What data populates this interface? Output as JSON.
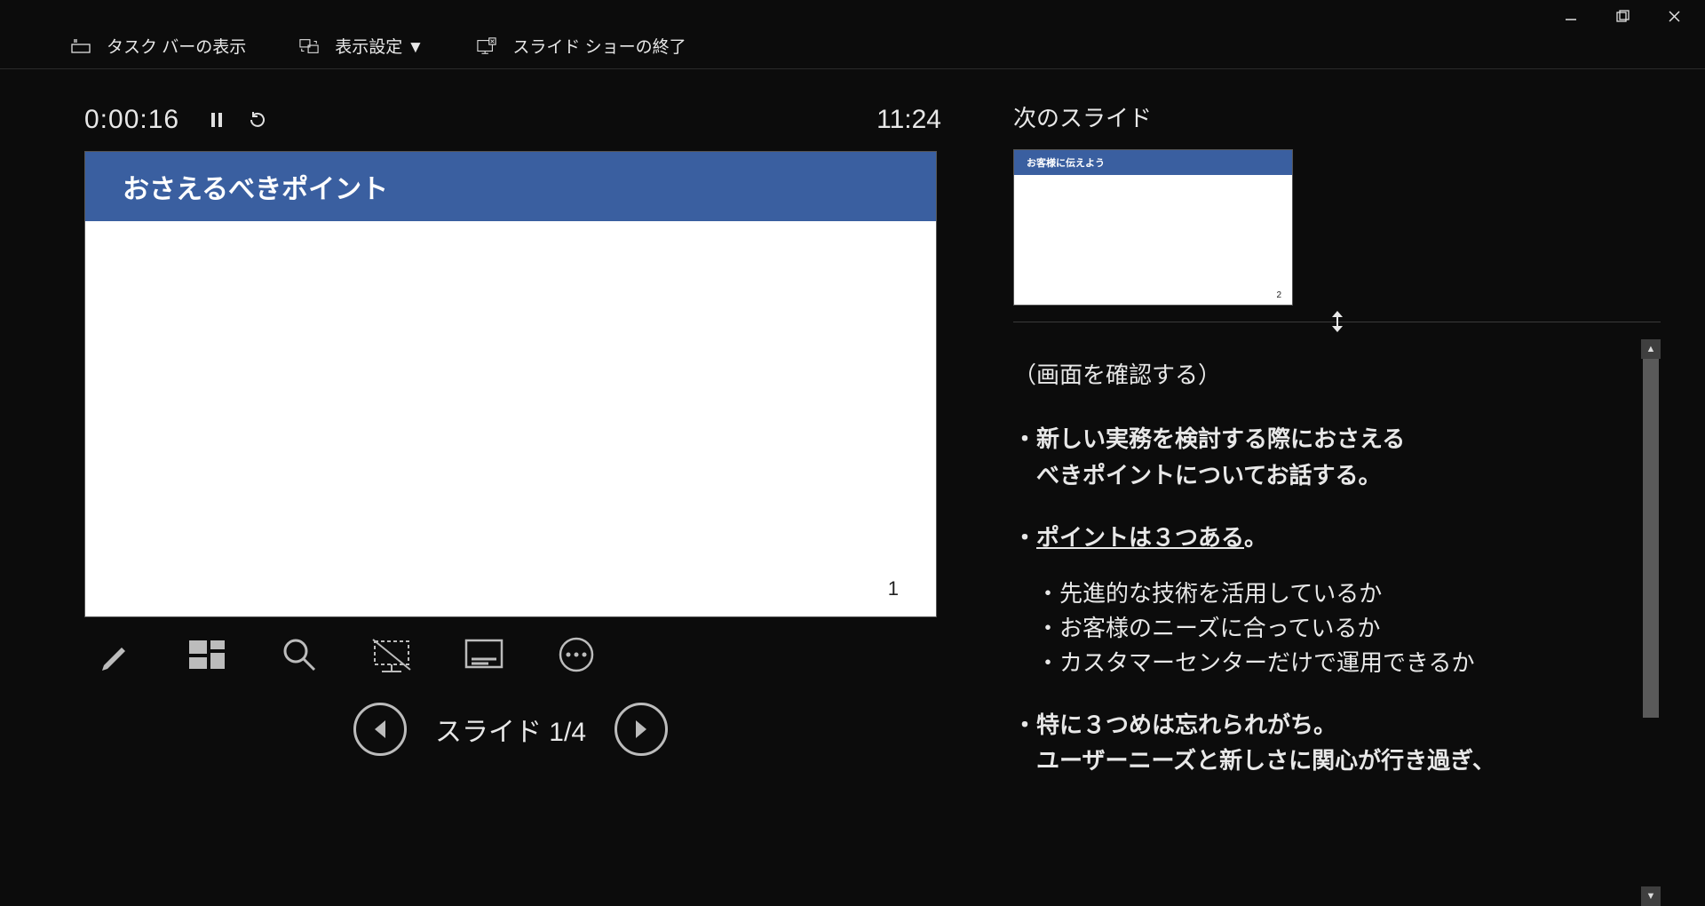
{
  "window": {
    "minimize": "—",
    "maximize": "❐",
    "close": "✕"
  },
  "toolbar": {
    "taskbar_label": "タスク バーの表示",
    "display_settings_label": "表示設定 ▼",
    "end_show_label": "スライド ショーの終了"
  },
  "timer": {
    "elapsed": "0:00:16",
    "clock": "11:24"
  },
  "current_slide": {
    "title": "おさえるべきポイント",
    "page_no": "1"
  },
  "tools": {
    "pen": "pen",
    "grid": "see-all-slides",
    "zoom": "zoom",
    "blackout": "black-screen",
    "subtitle": "subtitle",
    "more": "more"
  },
  "nav": {
    "counter": "スライド 1/4"
  },
  "next_slide": {
    "label": "次のスライド",
    "thumb_title": "お客様に伝えよう",
    "thumb_page": "2"
  },
  "notes": {
    "heading": "（画面を確認する）",
    "b1a": "・新しい実務を検討する際におさえる",
    "b1b": "べきポイントについてお話する。",
    "b2_pre": "・",
    "b2_u": "ポイントは３つある",
    "b2_post": "。",
    "sub1": "・先進的な技術を活用しているか",
    "sub2": "・お客様のニーズに合っているか",
    "sub3": "・カスタマーセンターだけで運用できるか",
    "b3": "・特に３つめは忘れられがち。",
    "b3b": "ユーザーニーズと新しさに関心が行き過ぎ、"
  }
}
